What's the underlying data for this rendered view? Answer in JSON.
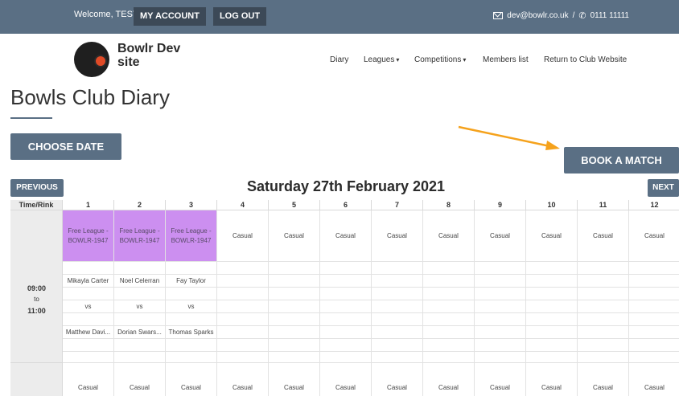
{
  "topbar": {
    "welcome": "Welcome, TEST!",
    "my_account": "MY ACCOUNT",
    "logout": "LOG OUT",
    "email": "dev@bowlr.co.uk",
    "separator": "/",
    "phone": "0111 11111"
  },
  "site": {
    "name": "Bowlr Dev site"
  },
  "nav": {
    "items": [
      {
        "label": "Diary"
      },
      {
        "label": "Leagues",
        "dropdown": true
      },
      {
        "label": "Competitions",
        "dropdown": true
      },
      {
        "label": "Members list"
      },
      {
        "label": "Return to Club Website"
      }
    ],
    "caret": "▾"
  },
  "page": {
    "title": "Bowls Club Diary",
    "choose_date": "CHOOSE DATE",
    "book_match": "BOOK A MATCH",
    "previous": "PREVIOUS",
    "next": "NEXT",
    "date": "Saturday 27th February 2021"
  },
  "grid": {
    "time_header": "Time/Rink",
    "rinks": [
      "1",
      "2",
      "3",
      "4",
      "5",
      "6",
      "7",
      "8",
      "9",
      "10",
      "11",
      "12"
    ],
    "slot1": {
      "time_start": "09:00",
      "time_to": "to",
      "time_end": "11:00",
      "league_text": "Free League - BOWLR-1947",
      "casual": "Casual",
      "home_players": [
        "Mikayla Carter",
        "Noel Celerran",
        "Fay Taylor"
      ],
      "vs": "vs",
      "away_players": [
        "Matthew Davi...",
        "Dorian Swars...",
        "Thomas Sparks"
      ]
    },
    "slot2": {
      "casual": "Casual"
    }
  },
  "colors": {
    "topbar": "#5a6f84",
    "league_cell": "#cc8ff0",
    "arrow": "#f5a21c",
    "logo_accent": "#e04a26"
  }
}
